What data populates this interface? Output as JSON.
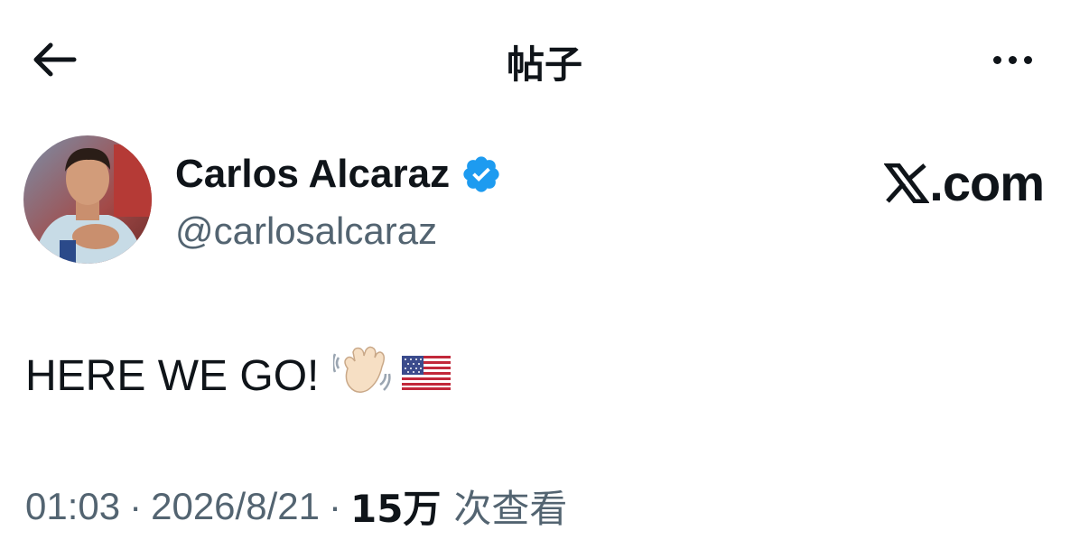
{
  "header": {
    "title": "帖子",
    "back_icon": "arrow-left-icon",
    "more_icon": "more-horizontal-icon"
  },
  "author": {
    "name": "Carlos Alcaraz",
    "handle": "@carlosalcaraz",
    "verified": true,
    "verified_color": "#1d9bf0",
    "avatar": "profile-photo"
  },
  "watermark": {
    "text": ".com",
    "logo": "x-logo-icon"
  },
  "tweet": {
    "text": "HERE WE GO!",
    "emojis": [
      "waving-hand-emoji",
      "us-flag-emoji"
    ]
  },
  "meta": {
    "time": "01:03",
    "separator": "·",
    "date": "2026/8/21",
    "views_count": "15万",
    "views_label": "次查看"
  },
  "colors": {
    "text_primary": "#0f1419",
    "text_secondary": "#536471",
    "background": "#ffffff"
  }
}
